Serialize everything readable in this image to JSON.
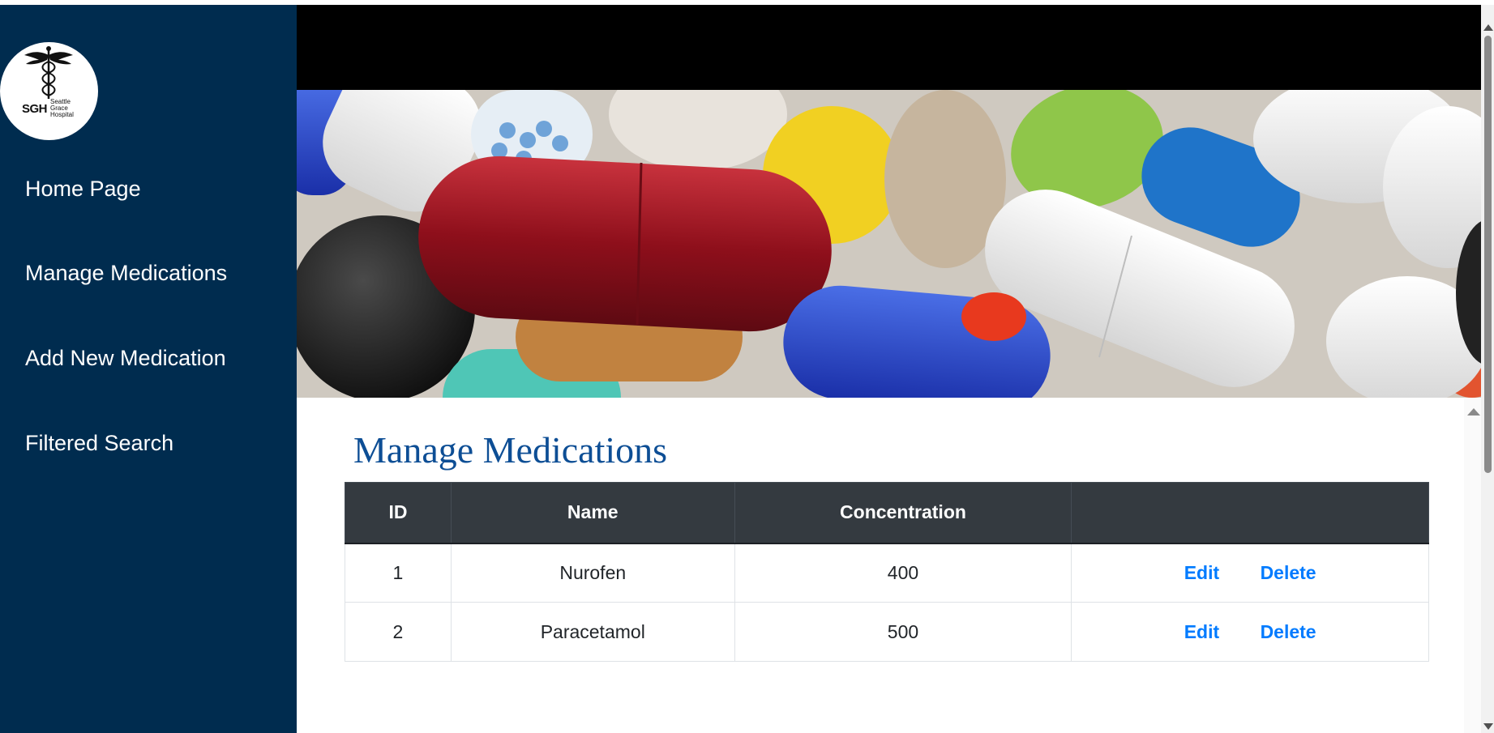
{
  "sidebar": {
    "logo": {
      "abbr": "SGH",
      "line1": "Seattle",
      "line2": "Grace",
      "line3": "Hospital",
      "icon": "caduceus-icon"
    },
    "items": [
      {
        "label": "Home Page"
      },
      {
        "label": "Manage Medications"
      },
      {
        "label": "Add New Medication"
      },
      {
        "label": "Filtered Search"
      }
    ]
  },
  "main": {
    "title": "Manage Medications",
    "table": {
      "headers": [
        "ID",
        "Name",
        "Concentration",
        ""
      ],
      "rows": [
        {
          "id": "1",
          "name": "Nurofen",
          "concentration": "400",
          "edit": "Edit",
          "delete": "Delete"
        },
        {
          "id": "2",
          "name": "Paracetamol",
          "concentration": "500",
          "edit": "Edit",
          "delete": "Delete"
        }
      ]
    }
  },
  "colors": {
    "sidebar_bg": "#002c4f",
    "title": "#0d4e95",
    "table_header_bg": "#343a40",
    "link": "#007bff"
  }
}
